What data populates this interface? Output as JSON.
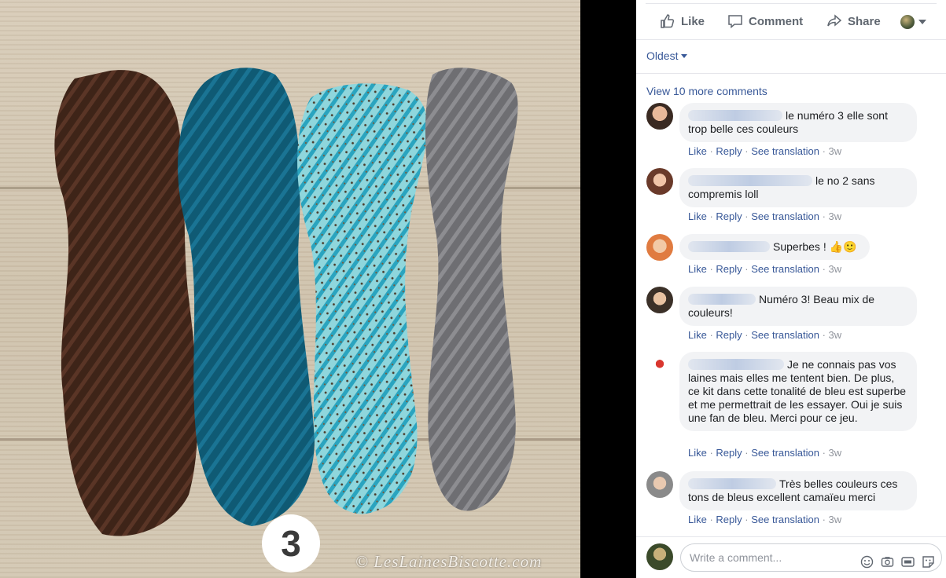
{
  "photo": {
    "badge_number": "3",
    "watermark": "© LesLainesBiscotte.com"
  },
  "actions": {
    "like": "Like",
    "comment": "Comment",
    "share": "Share"
  },
  "sort_label": "Oldest",
  "view_more": "View 10 more comments",
  "comments": [
    {
      "text": "le numéro 3 elle sont trop belle ces couleurs",
      "time": "3w"
    },
    {
      "text": "le no 2 sans compremis loll",
      "time": "3w"
    },
    {
      "text": "Superbes ! 👍🙂",
      "time": "3w"
    },
    {
      "text": "Numéro 3! Beau mix de couleurs!",
      "time": "3w"
    },
    {
      "text": "Je ne connais pas vos laines mais elles me tentent bien. De plus, ce kit dans cette tonalité de bleu est superbe et me permettrait de les essayer. Oui je suis une fan de bleu. Merci pour ce jeu.",
      "time": "3w"
    },
    {
      "text": "Très belles couleurs ces tons de bleus excellent camaïeu merci",
      "time": "3w"
    }
  ],
  "meta_labels": {
    "like": "Like",
    "reply": "Reply",
    "translate": "See translation",
    "sep": " · "
  },
  "composer": {
    "placeholder": "Write a comment..."
  },
  "icons": [
    "thumbs-up",
    "speech-bubble",
    "share-arrow",
    "globe",
    "emoji",
    "camera",
    "gif",
    "sticker"
  ]
}
